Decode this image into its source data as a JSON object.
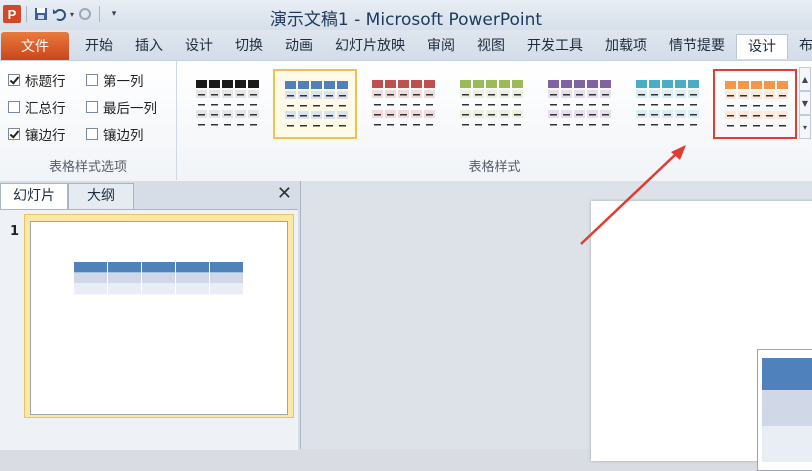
{
  "app": {
    "title": "演示文稿1 - Microsoft PowerPoint",
    "logo_letter": "P"
  },
  "qat": {
    "icons": [
      "save-icon",
      "undo-icon",
      "dropdown-icon",
      "redo-icon",
      "customize-icon"
    ]
  },
  "ribbon_tabs": {
    "file": "文件",
    "items": [
      "开始",
      "插入",
      "设计",
      "切换",
      "动画",
      "幻灯片放映",
      "审阅",
      "视图",
      "开发工具",
      "加载项",
      "情节提要",
      "设计",
      "布局"
    ],
    "active_index": 11
  },
  "table_style_options": {
    "header_row": {
      "label": "标题行",
      "checked": true
    },
    "first_column": {
      "label": "第一列",
      "checked": false
    },
    "total_row": {
      "label": "汇总行",
      "checked": false
    },
    "last_column": {
      "label": "最后一列",
      "checked": false
    },
    "banded_rows": {
      "label": "镶边行",
      "checked": true
    },
    "banded_columns": {
      "label": "镶边列",
      "checked": false
    },
    "group_label": "表格样式选项"
  },
  "table_styles": {
    "group_label": "表格样式",
    "swatches": [
      {
        "name": "black",
        "header": "#1a1a1a",
        "band": "#e6e6e6"
      },
      {
        "name": "blue",
        "header": "#4f81bd",
        "band": "#dbe3ef",
        "selected": true
      },
      {
        "name": "red",
        "header": "#c0504d",
        "band": "#f2dcdb"
      },
      {
        "name": "green",
        "header": "#9bbb59",
        "band": "#ebf1de"
      },
      {
        "name": "purple",
        "header": "#8064a2",
        "band": "#e5e0ec"
      },
      {
        "name": "aqua",
        "header": "#4bacc6",
        "band": "#dbeef4"
      },
      {
        "name": "orange",
        "header": "#f79646",
        "band": "#fde9d9",
        "highlight": true
      }
    ]
  },
  "slide_pane": {
    "tabs": [
      "幻灯片",
      "大纲"
    ],
    "active_tab": 0,
    "slide_number": "1",
    "thumb_table": {
      "cols": 5,
      "header": "#4f81bd",
      "band1": "#d0d8e8",
      "band2": "#e9edf4"
    }
  },
  "colors": {
    "accent_file": "#d24726",
    "highlight_red": "#e03c31",
    "selected_gold": "#f0c24b"
  }
}
